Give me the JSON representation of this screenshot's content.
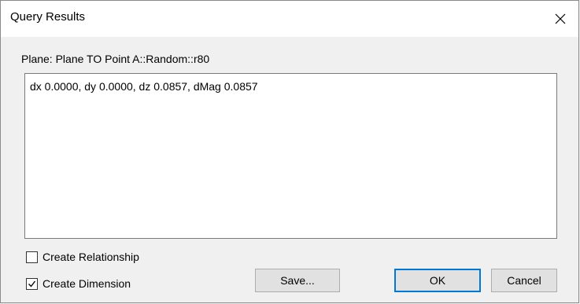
{
  "window": {
    "title": "Query Results"
  },
  "query": {
    "plane_label": "Plane: Plane TO Point A::Random::r80",
    "result_text": "dx 0.0000, dy 0.0000, dz 0.0857, dMag 0.0857"
  },
  "options": {
    "create_relationship": {
      "label": "Create Relationship",
      "checked": false
    },
    "create_dimension": {
      "label": "Create Dimension",
      "checked": true
    }
  },
  "buttons": {
    "save": "Save...",
    "ok": "OK",
    "cancel": "Cancel"
  }
}
